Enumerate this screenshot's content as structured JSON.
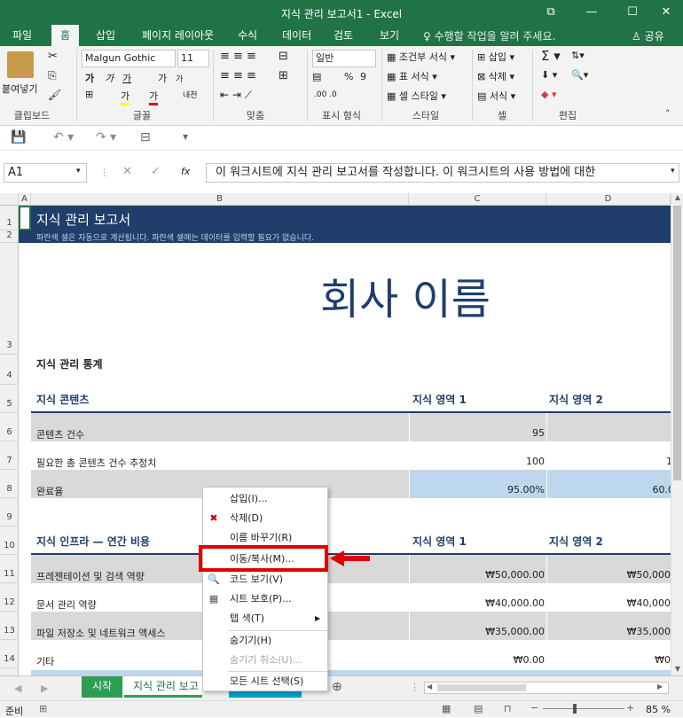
{
  "window": {
    "title": "지식 관리 보고서1 - Excel",
    "restore_icon": "⧉",
    "minimize_icon": "—",
    "maximize_icon": "☐",
    "close_icon": "✕"
  },
  "tabs": [
    "파일",
    "홈",
    "삽입",
    "페이지 레이아웃",
    "수식",
    "데이터",
    "검토",
    "보기"
  ],
  "tell_me": "♀ 수행할 작업을 알려 주세요.",
  "share": "공유",
  "ribbon": {
    "clipboard": {
      "paste": "붙여넣기",
      "label": "클립보드"
    },
    "font": {
      "name": "Malgun Gothic",
      "size": "11",
      "label": "글꼴",
      "bold": "가",
      "italic": "가",
      "underline": "가",
      "grow": "가",
      "shrink": "가",
      "fill": "가",
      "color": "가",
      "phonetic": "내천"
    },
    "align": {
      "label": "맞춤"
    },
    "number": {
      "format": "일반",
      "percent": "%",
      "comma": "9",
      "label": "표시 형식"
    },
    "styles": {
      "cond": "조건부 서식",
      "table": "표 서식",
      "cell": "셀 스타일",
      "label": "스타일"
    },
    "cells": {
      "insert": "삽입",
      "delete": "삭제",
      "format": "서식",
      "label": "셀"
    },
    "editing": {
      "label": "편집"
    }
  },
  "formula_bar": {
    "name_box": "A1",
    "fx": "fx",
    "value": "이 워크시트에 지식 관리 보고서를 작성합니다. 이 워크시트의 사용 방법에 대한"
  },
  "columns": [
    "A",
    "B",
    "C",
    "D"
  ],
  "rows": [
    "1",
    "2",
    "3",
    "4",
    "5",
    "6",
    "7",
    "8",
    "9",
    "10",
    "11",
    "12",
    "13",
    "14"
  ],
  "sheet": {
    "title": "지식 관리 보고서",
    "subtitle": "파란색 셀은 자동으로 계산됩니다. 파란색 셀에는 데이터를 입력할 필요가 없습니다.",
    "company": "회사 이름",
    "stats_heading": "지식 관리 통계",
    "content_heading": "지식 콘텐츠",
    "area1": "지식 영역 1",
    "area2": "지식 영역 2",
    "r6_label": "콘텐츠 건수",
    "r6_c": "95",
    "r6_d": "",
    "r7_label": "필요한 총 콘텐츠 건수 추정치",
    "r7_c": "100",
    "r7_d": "1",
    "r8_label": "완료율",
    "r8_c": "95.00%",
    "r8_d": "60.0",
    "infra_heading": "지식 인프라 — 연간 비용",
    "r11_label": "프레젠테이션 및 검색 역량",
    "r11_c": "₩50,000.00",
    "r11_d": "₩50,000",
    "r12_label": "문서 관리 역량",
    "r12_c": "₩40,000.00",
    "r12_d": "₩40,000",
    "r13_label": "파일 저장소 및 네트워크 액세스",
    "r13_c": "₩35,000.00",
    "r13_d": "₩35,000",
    "r14_label": "기타",
    "r14_c": "₩0.00",
    "r14_d": "₩0"
  },
  "context_menu": [
    {
      "label": "삽입(I)...",
      "icon": "",
      "disabled": false
    },
    {
      "label": "삭제(D)",
      "icon": "✖",
      "disabled": false
    },
    {
      "label": "이름 바꾸기(R)",
      "icon": "",
      "disabled": false
    },
    {
      "label": "이동/복사(M)...",
      "icon": "",
      "disabled": false
    },
    {
      "label": "코드 보기(V)",
      "icon": "🔍",
      "disabled": false
    },
    {
      "label": "시트 보호(P)...",
      "icon": "▦",
      "disabled": false
    },
    {
      "label": "탭 색(T)",
      "icon": "",
      "disabled": false,
      "submenu": true
    },
    {
      "label": "숨기기(H)",
      "icon": "",
      "disabled": false
    },
    {
      "label": "숨기기 취소(U)...",
      "icon": "",
      "disabled": true
    },
    {
      "label": "모든 시트 선택(S)",
      "icon": "",
      "disabled": false
    }
  ],
  "sheet_tabs": [
    "시작",
    "지식 관리 보고"
  ],
  "status": {
    "ready": "준비",
    "zoom": "85 %"
  },
  "colors": {
    "excel_green": "#217346",
    "navy": "#1f3e6b",
    "gray_band": "#d9d9d9",
    "blue_cell": "#bdd7ee",
    "arrow": "#e00000"
  }
}
